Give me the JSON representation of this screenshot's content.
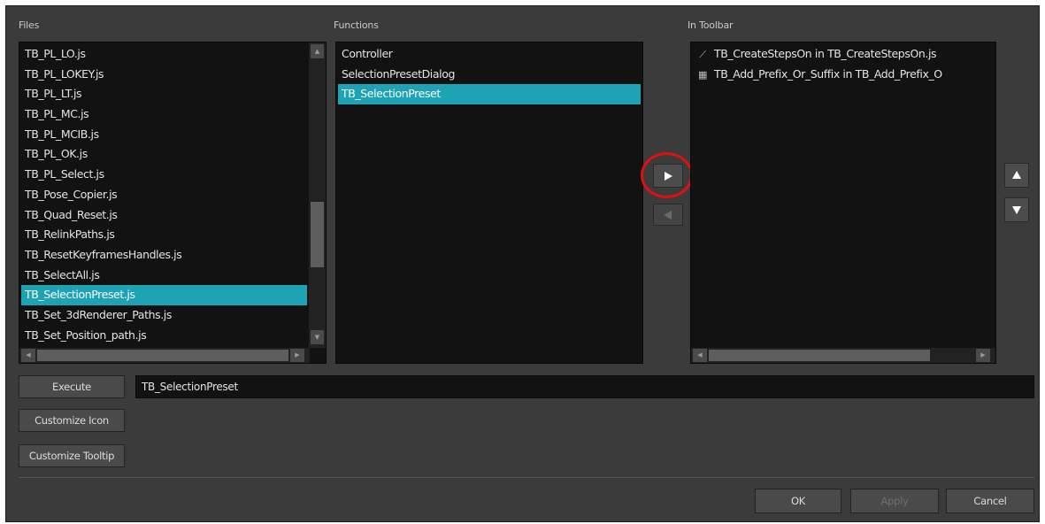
{
  "sections": {
    "files": "Files",
    "functions": "Functions",
    "in_toolbar": "In Toolbar"
  },
  "files": {
    "items": [
      "TB_PL_LO.js",
      "TB_PL_LOKEY.js",
      "TB_PL_LT.js",
      "TB_PL_MC.js",
      "TB_PL_MCIB.js",
      "TB_PL_OK.js",
      "TB_PL_Select.js",
      "TB_Pose_Copier.js",
      "TB_Quad_Reset.js",
      "TB_RelinkPaths.js",
      "TB_ResetKeyframesHandles.js",
      "TB_SelectAll.js",
      "TB_SelectionPreset.js",
      "TB_Set_3dRenderer_Paths.js",
      "TB_Set_Position_path.js"
    ],
    "selected_index": 12
  },
  "functions": {
    "items": [
      "Controller",
      "SelectionPresetDialog",
      "TB_SelectionPreset"
    ],
    "selected_index": 2
  },
  "toolbar": {
    "items": [
      {
        "icon": "curve-icon",
        "label": "TB_CreateStepsOn in TB_CreateStepsOn.js"
      },
      {
        "icon": "prefix-suffix-icon",
        "label": "TB_Add_Prefix_Or_Suffix in TB_Add_Prefix_O"
      }
    ]
  },
  "buttons": {
    "execute": "Execute",
    "customize_icon": "Customize Icon",
    "customize_tooltip": "Customize Tooltip",
    "ok": "OK",
    "apply": "Apply",
    "cancel": "Cancel"
  },
  "execute_field": {
    "value": "TB_SelectionPreset"
  },
  "colors": {
    "selection": "#1ea3b5",
    "highlight_circle": "#e01010"
  }
}
